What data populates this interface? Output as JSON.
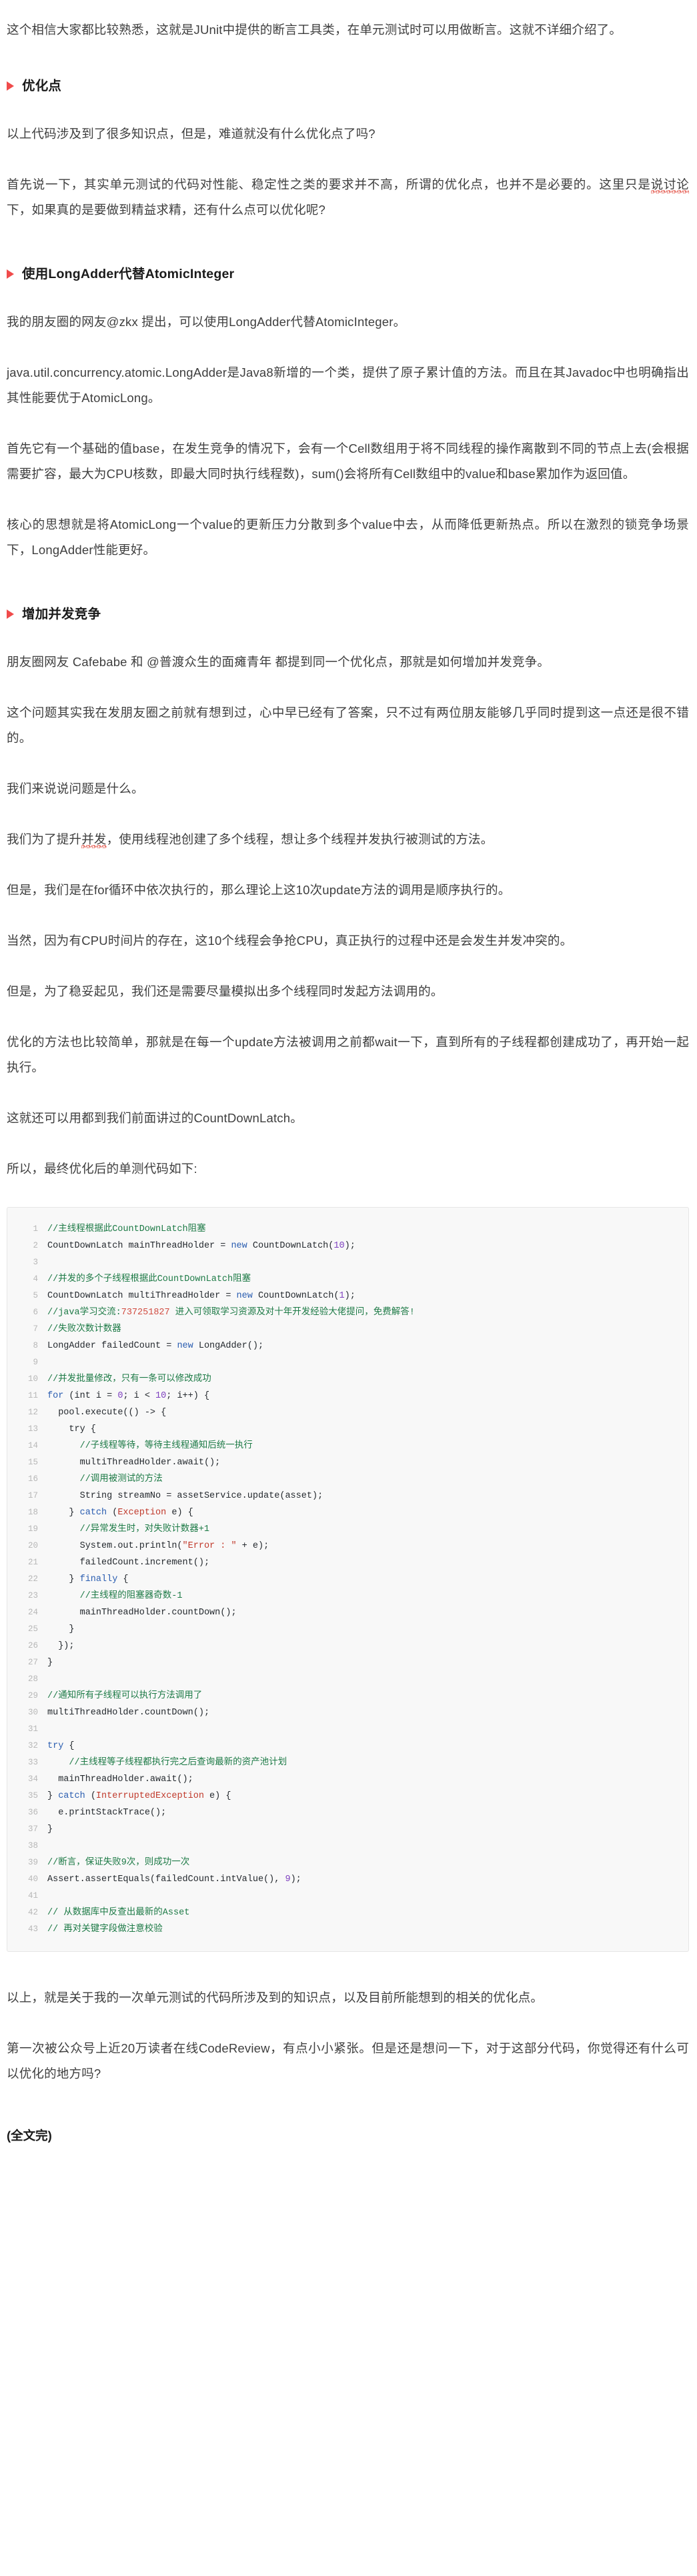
{
  "theme": {
    "accent_red": "#f04b4b",
    "text": "#3e3e3e",
    "code_bg": "#f8f8f8",
    "comment_green": "#1d7a46",
    "keyword_blue": "#2a5db0",
    "type_red": "#c0392b",
    "number_purple": "#7d3fbf"
  },
  "article": {
    "intro": {
      "p1": "这个相信大家都比较熟悉，这就是JUnit中提供的断言工具类，在单元测试时可以用做断言。这就不详细介绍了。"
    },
    "section_optimize": {
      "heading": "优化点",
      "p1": "以上代码涉及到了很多知识点，但是，难道就没有什么优化点了吗?",
      "p2_a": "首先说一下，其实单元测试的代码对性能、稳定性之类的要求并不高，所谓的优化点，也并不是必要的。这里只是",
      "p2_sq": "说讨论",
      "p2_b": "下，如果真的是要做到精益求精，还有什么点可以优化呢?"
    },
    "section_longadder": {
      "heading": "使用LongAdder代替AtomicInteger",
      "p1": "我的朋友圈的网友@zkx 提出，可以使用LongAdder代替AtomicInteger。",
      "p2": "java.util.concurrency.atomic.LongAdder是Java8新增的一个类，提供了原子累计值的方法。而且在其Javadoc中也明确指出其性能要优于AtomicLong。",
      "p3": "首先它有一个基础的值base，在发生竞争的情况下，会有一个Cell数组用于将不同线程的操作离散到不同的节点上去(会根据需要扩容，最大为CPU核数，即最大同时执行线程数)，sum()会将所有Cell数组中的value和base累加作为返回值。",
      "p4": "核心的思想就是将AtomicLong一个value的更新压力分散到多个value中去，从而降低更新热点。所以在激烈的锁竞争场景下，LongAdder性能更好。"
    },
    "section_concurrency": {
      "heading": "增加并发竞争",
      "p1": "朋友圈网友 Cafebabe 和 @普渡众生的面瘫青年 都提到同一个优化点，那就是如何增加并发竞争。",
      "p2": "这个问题其实我在发朋友圈之前就有想到过，心中早已经有了答案，只不过有两位朋友能够几乎同时提到这一点还是很不错的。",
      "p3": "我们来说说问题是什么。",
      "p4_a": "我们为了提升",
      "p4_sq": "并发",
      "p4_b": "，使用线程池创建了多个线程，想让多个线程并发执行被测试的方法。",
      "p5": "但是，我们是在for循环中依次执行的，那么理论上这10次update方法的调用是顺序执行的。",
      "p6": "当然，因为有CPU时间片的存在，这10个线程会争抢CPU，真正执行的过程中还是会发生并发冲突的。",
      "p7": "但是，为了稳妥起见，我们还是需要尽量模拟出多个线程同时发起方法调用的。",
      "p8": "优化的方法也比较简单，那就是在每一个update方法被调用之前都wait一下，直到所有的子线程都创建成功了，再开始一起执行。",
      "p9": "这就还可以用都到我们前面讲过的CountDownLatch。",
      "p10": "所以，最终优化后的单测代码如下:"
    },
    "conclusion": {
      "p1": "以上，就是关于我的一次单元测试的代码所涉及到的知识点，以及目前所能想到的相关的优化点。",
      "p2": "第一次被公众号上近20万读者在线CodeReview，有点小小紧张。但是还是想问一下，对于这部分代码，你觉得还有什么可以优化的地方吗?",
      "p3": "(全文完)"
    }
  },
  "code_block": {
    "language": "java",
    "lines": [
      {
        "n": "1",
        "tokens": [
          {
            "t": "//主线程根据此CountDownLatch阻塞",
            "c": "cm"
          }
        ]
      },
      {
        "n": "2",
        "tokens": [
          {
            "t": "CountDownLatch mainThreadHolder = ",
            "c": ""
          },
          {
            "t": "new",
            "c": "kw"
          },
          {
            "t": " CountDownLatch(",
            "c": ""
          },
          {
            "t": "10",
            "c": "nu"
          },
          {
            "t": ");",
            "c": ""
          }
        ]
      },
      {
        "n": "3",
        "tokens": [
          {
            "t": "",
            "c": ""
          }
        ]
      },
      {
        "n": "4",
        "tokens": [
          {
            "t": "//并发的多个子线程根据此CountDownLatch阻塞",
            "c": "cm"
          }
        ]
      },
      {
        "n": "5",
        "tokens": [
          {
            "t": "CountDownLatch multiThreadHolder = ",
            "c": ""
          },
          {
            "t": "new",
            "c": "kw"
          },
          {
            "t": " CountDownLatch(",
            "c": ""
          },
          {
            "t": "1",
            "c": "nu"
          },
          {
            "t": ");",
            "c": ""
          }
        ]
      },
      {
        "n": "6",
        "tokens": [
          {
            "t": "//java学习交流:",
            "c": "cm"
          },
          {
            "t": "737251827",
            "c": "qq"
          },
          {
            "t": " 进入可领取学习资源及对十年开发经验大佬提问，免费解答!",
            "c": "cm"
          }
        ]
      },
      {
        "n": "7",
        "tokens": [
          {
            "t": "//失败次数计数器",
            "c": "cm"
          }
        ]
      },
      {
        "n": "8",
        "tokens": [
          {
            "t": "LongAdder failedCount = ",
            "c": ""
          },
          {
            "t": "new",
            "c": "kw"
          },
          {
            "t": " LongAdder();",
            "c": ""
          }
        ]
      },
      {
        "n": "9",
        "tokens": [
          {
            "t": "",
            "c": ""
          }
        ]
      },
      {
        "n": "10",
        "tokens": [
          {
            "t": "//并发批量修改，只有一条可以修改成功",
            "c": "cm"
          }
        ]
      },
      {
        "n": "11",
        "tokens": [
          {
            "t": "for",
            "c": "kw"
          },
          {
            "t": " (int i = ",
            "c": ""
          },
          {
            "t": "0",
            "c": "nu"
          },
          {
            "t": "; i < ",
            "c": ""
          },
          {
            "t": "10",
            "c": "nu"
          },
          {
            "t": "; i++) {",
            "c": ""
          }
        ]
      },
      {
        "n": "12",
        "tokens": [
          {
            "t": "  pool.execute(() -> {",
            "c": ""
          }
        ]
      },
      {
        "n": "13",
        "tokens": [
          {
            "t": "    try {",
            "c": ""
          }
        ]
      },
      {
        "n": "14",
        "tokens": [
          {
            "t": "      //子线程等待，等待主线程通知后统一执行",
            "c": "cm"
          }
        ]
      },
      {
        "n": "15",
        "tokens": [
          {
            "t": "      multiThreadHolder.await();",
            "c": ""
          }
        ]
      },
      {
        "n": "16",
        "tokens": [
          {
            "t": "      //调用被测试的方法",
            "c": "cm"
          }
        ]
      },
      {
        "n": "17",
        "tokens": [
          {
            "t": "      String streamNo = assetService.update(asset);",
            "c": ""
          }
        ]
      },
      {
        "n": "18",
        "tokens": [
          {
            "t": "    } ",
            "c": ""
          },
          {
            "t": "catch",
            "c": "kw"
          },
          {
            "t": " (",
            "c": ""
          },
          {
            "t": "Exception",
            "c": "ty"
          },
          {
            "t": " e) {",
            "c": ""
          }
        ]
      },
      {
        "n": "19",
        "tokens": [
          {
            "t": "      //异常发生时，对失败计数器+1",
            "c": "cm"
          }
        ]
      },
      {
        "n": "20",
        "tokens": [
          {
            "t": "      System.out.println(",
            "c": ""
          },
          {
            "t": "\"Error : \"",
            "c": "st"
          },
          {
            "t": " + e);",
            "c": ""
          }
        ]
      },
      {
        "n": "21",
        "tokens": [
          {
            "t": "      failedCount.increment();",
            "c": ""
          }
        ]
      },
      {
        "n": "22",
        "tokens": [
          {
            "t": "    } ",
            "c": ""
          },
          {
            "t": "finally",
            "c": "kw"
          },
          {
            "t": " {",
            "c": ""
          }
        ]
      },
      {
        "n": "23",
        "tokens": [
          {
            "t": "      //主线程的阻塞器奇数-1",
            "c": "cm"
          }
        ]
      },
      {
        "n": "24",
        "tokens": [
          {
            "t": "      mainThreadHolder.countDown();",
            "c": ""
          }
        ]
      },
      {
        "n": "25",
        "tokens": [
          {
            "t": "    }",
            "c": ""
          }
        ]
      },
      {
        "n": "26",
        "tokens": [
          {
            "t": "  });",
            "c": ""
          }
        ]
      },
      {
        "n": "27",
        "tokens": [
          {
            "t": "}",
            "c": ""
          }
        ]
      },
      {
        "n": "28",
        "tokens": [
          {
            "t": "",
            "c": ""
          }
        ]
      },
      {
        "n": "29",
        "tokens": [
          {
            "t": "//通知所有子线程可以执行方法调用了",
            "c": "cm"
          }
        ]
      },
      {
        "n": "30",
        "tokens": [
          {
            "t": "multiThreadHolder.countDown();",
            "c": ""
          }
        ]
      },
      {
        "n": "31",
        "tokens": [
          {
            "t": "",
            "c": ""
          }
        ]
      },
      {
        "n": "32",
        "tokens": [
          {
            "t": "try",
            "c": "kw"
          },
          {
            "t": " {",
            "c": ""
          }
        ]
      },
      {
        "n": "33",
        "tokens": [
          {
            "t": "    //主线程等子线程都执行完之后查询最新的资产池计划",
            "c": "cm"
          }
        ]
      },
      {
        "n": "34",
        "tokens": [
          {
            "t": "  mainThreadHolder.await();",
            "c": ""
          }
        ]
      },
      {
        "n": "35",
        "tokens": [
          {
            "t": "} ",
            "c": ""
          },
          {
            "t": "catch",
            "c": "kw"
          },
          {
            "t": " (",
            "c": ""
          },
          {
            "t": "InterruptedException",
            "c": "ty"
          },
          {
            "t": " e) {",
            "c": ""
          }
        ]
      },
      {
        "n": "36",
        "tokens": [
          {
            "t": "  e.printStackTrace();",
            "c": ""
          }
        ]
      },
      {
        "n": "37",
        "tokens": [
          {
            "t": "}",
            "c": ""
          }
        ]
      },
      {
        "n": "38",
        "tokens": [
          {
            "t": "",
            "c": ""
          }
        ]
      },
      {
        "n": "39",
        "tokens": [
          {
            "t": "//断言，保证失败9次，则成功一次",
            "c": "cm"
          }
        ]
      },
      {
        "n": "40",
        "tokens": [
          {
            "t": "Assert.assertEquals(failedCount.intValue(), ",
            "c": ""
          },
          {
            "t": "9",
            "c": "nu"
          },
          {
            "t": ");",
            "c": ""
          }
        ]
      },
      {
        "n": "41",
        "tokens": [
          {
            "t": "",
            "c": ""
          }
        ]
      },
      {
        "n": "42",
        "tokens": [
          {
            "t": "// 从数据库中反查出最新的Asset",
            "c": "cm"
          }
        ]
      },
      {
        "n": "43",
        "tokens": [
          {
            "t": "// 再对关键字段做注意校验",
            "c": "cm"
          }
        ]
      }
    ]
  }
}
